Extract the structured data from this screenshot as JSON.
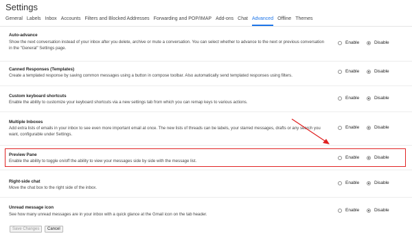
{
  "page_title": "Settings",
  "tabs": [
    {
      "label": "General",
      "active": false
    },
    {
      "label": "Labels",
      "active": false
    },
    {
      "label": "Inbox",
      "active": false
    },
    {
      "label": "Accounts",
      "active": false
    },
    {
      "label": "Filters and Blocked Addresses",
      "active": false
    },
    {
      "label": "Forwarding and POP/IMAP",
      "active": false
    },
    {
      "label": "Add-ons",
      "active": false
    },
    {
      "label": "Chat",
      "active": false
    },
    {
      "label": "Advanced",
      "active": true
    },
    {
      "label": "Offline",
      "active": false
    },
    {
      "label": "Themes",
      "active": false
    }
  ],
  "settings": [
    {
      "title": "Auto-advance",
      "description": "Show the next conversation instead of your inbox after you delete, archive or mute a conversation. You can select whether to advance to the next or previous conversation in the \"General\" Settings page.",
      "enable_label": "Enable",
      "disable_label": "Disable",
      "selected": "disable"
    },
    {
      "title": "Canned Responses (Templates)",
      "description": "Create a templated response by saving common messages using a button in compose toolbar. Also automatically send templated responses using filters.",
      "enable_label": "Enable",
      "disable_label": "Disable",
      "selected": "disable"
    },
    {
      "title": "Custom keyboard shortcuts",
      "description": "Enable the ability to customize your keyboard shortcuts via a new settings tab from which you can remap keys to various actions.",
      "enable_label": "Enable",
      "disable_label": "Disable",
      "selected": "disable"
    },
    {
      "title": "Multiple Inboxes",
      "description": "Add extra lists of emails in your inbox to see even more important email at once. The new lists of threads can be labels, your starred messages, drafts or any search you want, configurable under Settings.",
      "enable_label": "Enable",
      "disable_label": "Disable",
      "selected": "disable"
    },
    {
      "title": "Preview Pane",
      "description": "Enable the ability to toggle on/off the ability to view your messages side by side with the message list.",
      "enable_label": "Enable",
      "disable_label": "Disable",
      "selected": "disable"
    },
    {
      "title": "Right-side chat",
      "description": "Move the chat box to the right side of the inbox.",
      "enable_label": "Enable",
      "disable_label": "Disable",
      "selected": "disable"
    },
    {
      "title": "Unread message icon",
      "description": "See how many unread messages are in your inbox with a quick glance at the Gmail icon on the tab header.",
      "enable_label": "Enable",
      "disable_label": "Disable",
      "selected": "disable"
    }
  ],
  "buttons": {
    "save_label": "Save Changes",
    "cancel_label": "Cancel"
  },
  "annotation_color": "#e02020",
  "accent_color": "#1a73e8"
}
